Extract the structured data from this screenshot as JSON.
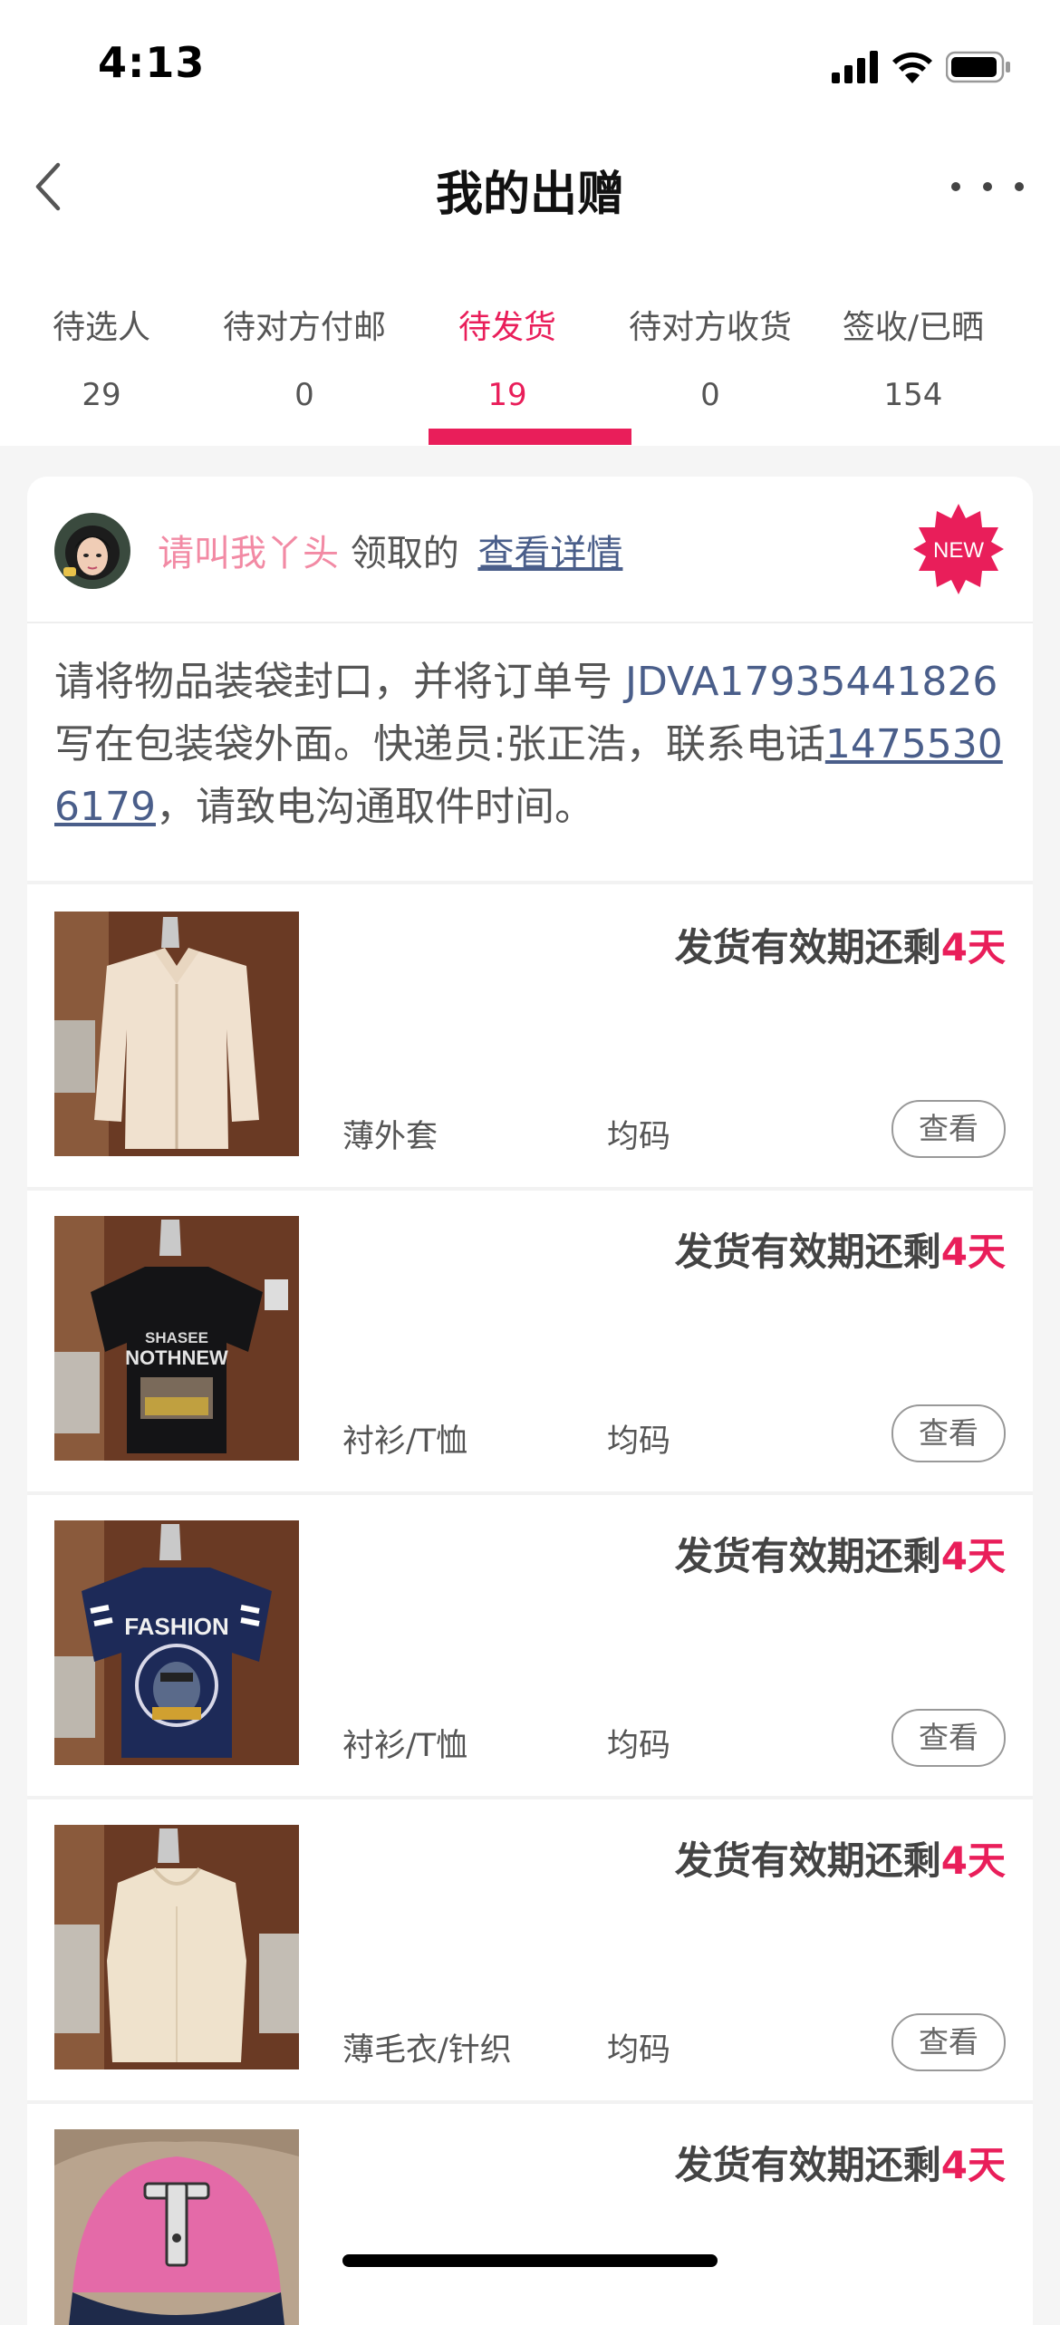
{
  "status_bar": {
    "time": "4:13"
  },
  "nav": {
    "title": "我的出赠"
  },
  "tabs": [
    {
      "label": "待选人",
      "count": "29"
    },
    {
      "label": "待对方付邮",
      "count": "0"
    },
    {
      "label": "待发货",
      "count": "19",
      "active": true
    },
    {
      "label": "待对方收货",
      "count": "0"
    },
    {
      "label": "签收/已晒",
      "count": "154"
    }
  ],
  "card": {
    "claimer": "请叫我丫头",
    "claimed_text": "领取的",
    "detail_link": "查看详情",
    "badge": "NEW",
    "instruction": {
      "part1": "请将物品装袋封口，并将订单号 ",
      "order_no": "JDVA17935441826",
      "part2": " 写在包装袋外面。快递员:张正浩，联系电话",
      "phone": "14755306179",
      "part3": "，请致电沟通取件时间。"
    }
  },
  "items": [
    {
      "deadline_prefix": "发货有效期还剩",
      "deadline_days": "4天",
      "name": "薄外套",
      "size": "均码",
      "view_label": "查看"
    },
    {
      "deadline_prefix": "发货有效期还剩",
      "deadline_days": "4天",
      "name": "衬衫/T恤",
      "size": "均码",
      "view_label": "查看",
      "shirt_text_1": "SHASEE",
      "shirt_text_2": "NOTHNEW"
    },
    {
      "deadline_prefix": "发货有效期还剩",
      "deadline_days": "4天",
      "name": "衬衫/T恤",
      "size": "均码",
      "view_label": "查看",
      "shirt_text": "FASHION"
    },
    {
      "deadline_prefix": "发货有效期还剩",
      "deadline_days": "4天",
      "name": "薄毛衣/针织",
      "size": "均码",
      "view_label": "查看"
    },
    {
      "deadline_prefix": "发货有效期还剩",
      "deadline_days": "4天"
    }
  ],
  "colors": {
    "accent": "#e91e5a",
    "link": "#4a5e8a",
    "claimer": "#f28aa4"
  }
}
